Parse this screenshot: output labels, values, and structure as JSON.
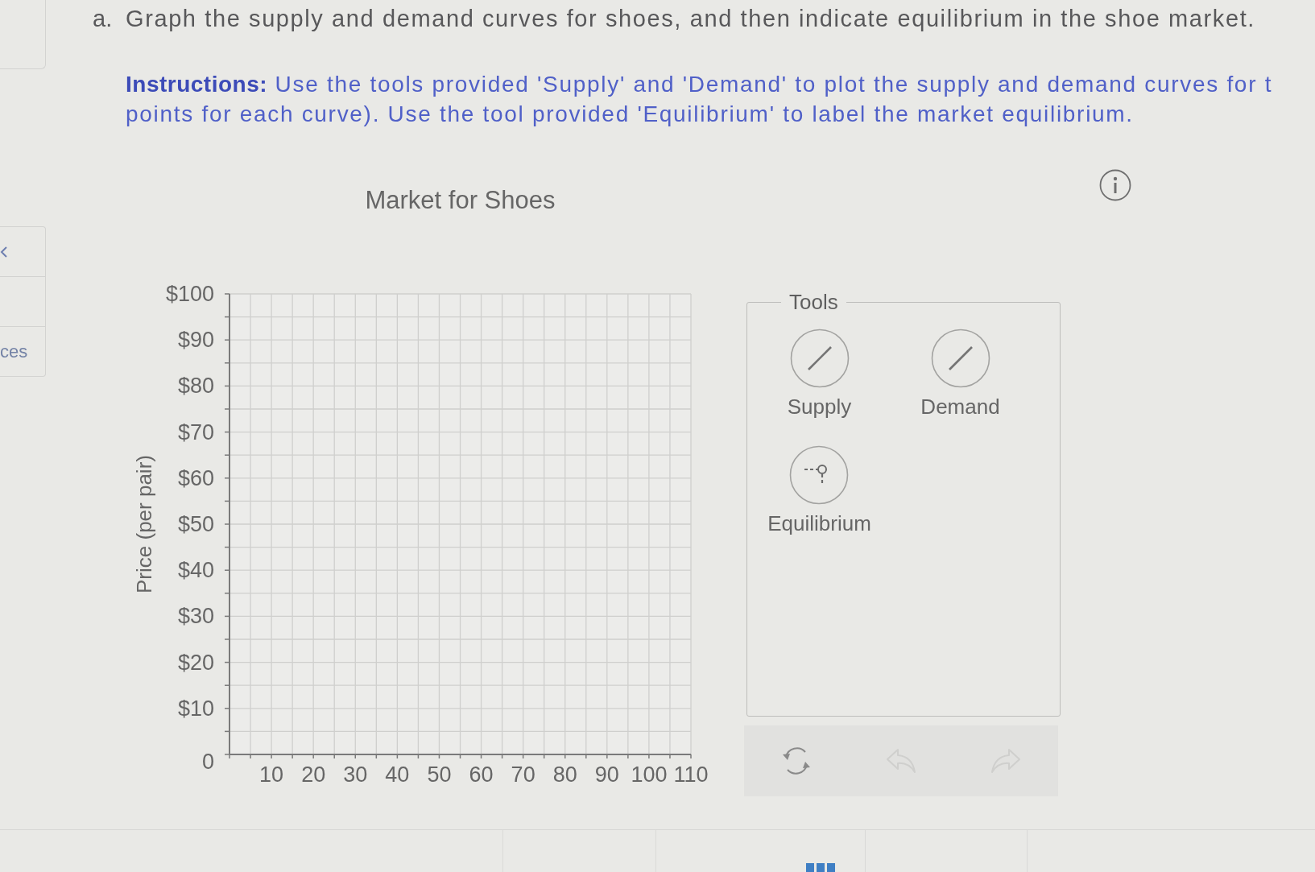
{
  "sidebar": {
    "items": [
      {
        "kind": "icon"
      },
      {
        "kind": "empty"
      },
      {
        "kind": "text",
        "label": "ces"
      }
    ]
  },
  "question": {
    "marker": "a.",
    "text": "Graph the supply and demand curves for shoes, and then indicate equilibrium in the shoe market."
  },
  "instructions": {
    "lines": [
      "**Instructions:** Use the tools provided 'Supply' and 'Demand' to plot the supply and demand curves for t",
      "points for each curve). Use the tool provided 'Equilibrium' to label the market equilibrium."
    ]
  },
  "graph": {
    "chart_data": [
      {
        "type": "line",
        "title": "Market for Shoes",
        "ylabel": "Price (per pair)",
        "xlim": [
          0,
          110
        ],
        "ylim": [
          0,
          100
        ],
        "xticks": [
          10,
          20,
          30,
          40,
          50,
          60,
          70,
          80,
          90,
          100,
          110
        ],
        "yticks": [
          {
            "value": 0,
            "label": "0"
          },
          {
            "value": 10,
            "label": "$10"
          },
          {
            "value": 20,
            "label": "$20"
          },
          {
            "value": 30,
            "label": "$30"
          },
          {
            "value": 40,
            "label": "$40"
          },
          {
            "value": 50,
            "label": "$50"
          },
          {
            "value": 60,
            "label": "$60"
          },
          {
            "value": 70,
            "label": "$70"
          },
          {
            "value": 80,
            "label": "$80"
          },
          {
            "value": 90,
            "label": "$90"
          },
          {
            "value": 100,
            "label": "$100"
          }
        ],
        "grid": true
      }
    ]
  },
  "tools": {
    "title": "Tools",
    "items": [
      {
        "kind": "line",
        "label": "Supply"
      },
      {
        "kind": "line",
        "label": "Demand"
      },
      {
        "kind": "point",
        "label": "Equilibrium"
      }
    ]
  },
  "toolbar": [
    {
      "kind": "reset",
      "disabled": false
    },
    {
      "kind": "undo",
      "disabled": true
    },
    {
      "kind": "redo",
      "disabled": true
    }
  ]
}
